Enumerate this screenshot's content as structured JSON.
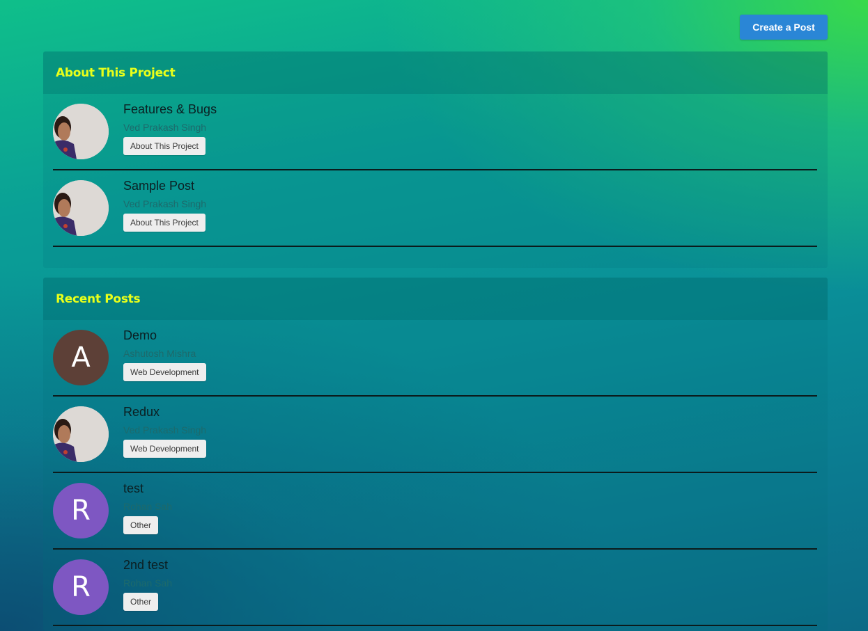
{
  "header": {
    "create_button": "Create a Post"
  },
  "about": {
    "title": "About This Project",
    "posts": [
      {
        "title": "Features & Bugs",
        "author": "Ved Prakash Singh",
        "tag": "About This Project",
        "avatar": "photo"
      },
      {
        "title": "Sample Post",
        "author": "Ved Prakash Singh",
        "tag": "About This Project",
        "avatar": "photo"
      }
    ]
  },
  "recent": {
    "title": "Recent Posts",
    "posts": [
      {
        "title": "Demo",
        "author": "Ashutosh Mishra",
        "tag": "Web Development",
        "avatar_letter": "A",
        "avatar_color": "#5d4037"
      },
      {
        "title": "Redux",
        "author": "Ved Prakash Singh",
        "tag": "Web Development",
        "avatar": "photo"
      },
      {
        "title": "test",
        "author": "Rohan Sah",
        "tag": "Other",
        "avatar_letter": "R",
        "avatar_color": "#7e57c2"
      },
      {
        "title": "2nd test",
        "author": "Rohan Sah",
        "tag": "Other",
        "avatar_letter": "R",
        "avatar_color": "#7e57c2"
      }
    ]
  },
  "colors": {
    "accent": "#2a86d6",
    "section_title": "#e9ff1a"
  }
}
